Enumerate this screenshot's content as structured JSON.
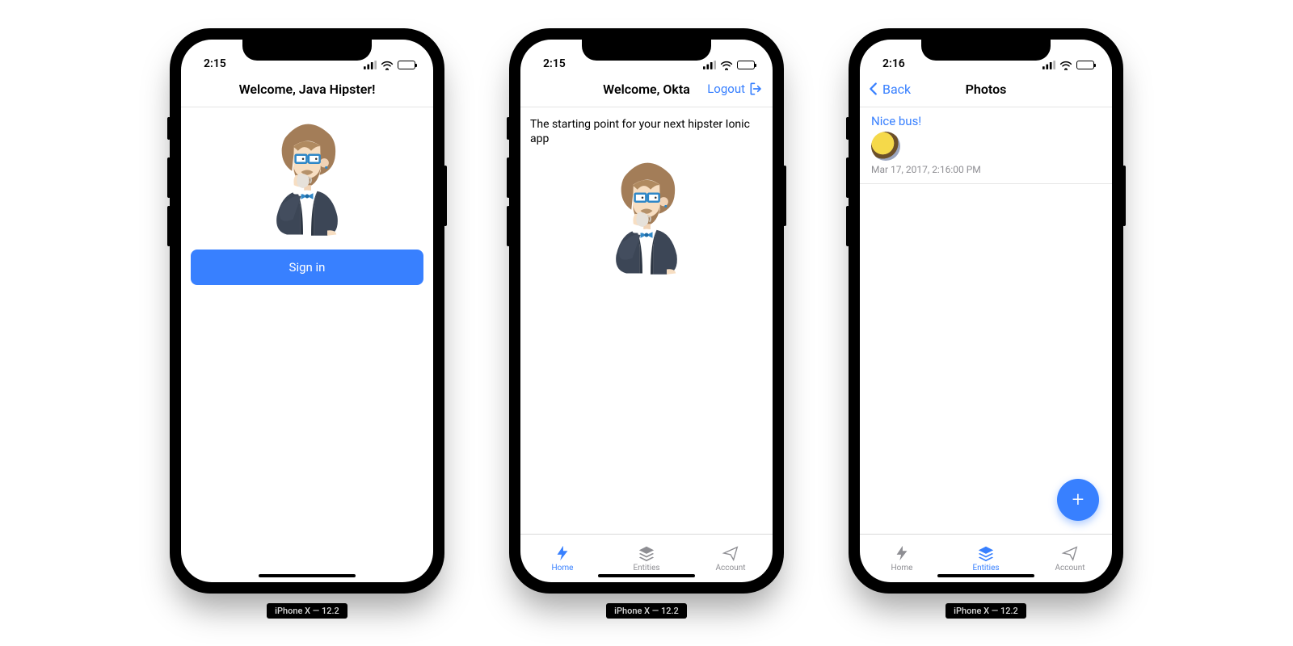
{
  "device_label": "iPhone X — 12.2",
  "colors": {
    "accent": "#3880ff"
  },
  "phones": [
    {
      "status": {
        "time": "2:15"
      },
      "header": {
        "title": "Welcome, Java Hipster!"
      },
      "signin_button": "Sign in"
    },
    {
      "status": {
        "time": "2:15"
      },
      "header": {
        "title": "Welcome, Okta",
        "logout": "Logout"
      },
      "description": "The starting point for your next hipster Ionic app",
      "tabs": [
        {
          "label": "Home",
          "icon": "bolt-icon",
          "active": true
        },
        {
          "label": "Entities",
          "icon": "layers-icon",
          "active": false
        },
        {
          "label": "Account",
          "icon": "paper-plane-icon",
          "active": false
        }
      ]
    },
    {
      "status": {
        "time": "2:16"
      },
      "header": {
        "title": "Photos",
        "back": "Back"
      },
      "list": [
        {
          "title": "Nice bus!",
          "timestamp": "Mar 17, 2017, 2:16:00 PM"
        }
      ],
      "fab": "+",
      "tabs": [
        {
          "label": "Home",
          "icon": "bolt-icon",
          "active": false
        },
        {
          "label": "Entities",
          "icon": "layers-icon",
          "active": true
        },
        {
          "label": "Account",
          "icon": "paper-plane-icon",
          "active": false
        }
      ]
    }
  ]
}
